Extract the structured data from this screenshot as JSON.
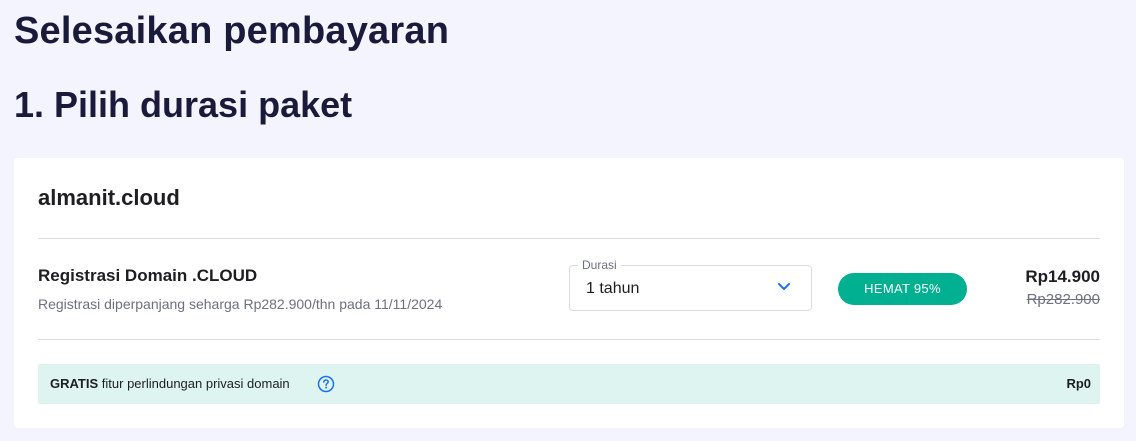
{
  "page": {
    "title": "Selesaikan pembayaran",
    "section_title": "1. Pilih durasi paket"
  },
  "card": {
    "domain": "almanit.cloud",
    "product": {
      "name": "Registrasi Domain .CLOUD",
      "renew_note": "Registrasi diperpanjang seharga Rp282.900/thn pada 11/11/2024"
    },
    "duration": {
      "label": "Durasi",
      "value": "1 tahun"
    },
    "badge": "HEMAT 95%",
    "price": {
      "current": "Rp14.900",
      "original": "Rp282.900"
    },
    "privacy": {
      "free_label": "GRATIS",
      "text": "fitur perlindungan privasi domain",
      "price": "Rp0",
      "help_icon": "question-circle-icon"
    }
  },
  "colors": {
    "background": "#f4f4ff",
    "heading": "#1a1b3a",
    "accent": "#00b090",
    "privacy_bg": "#def4f0",
    "link_blue": "#1a73e8"
  }
}
